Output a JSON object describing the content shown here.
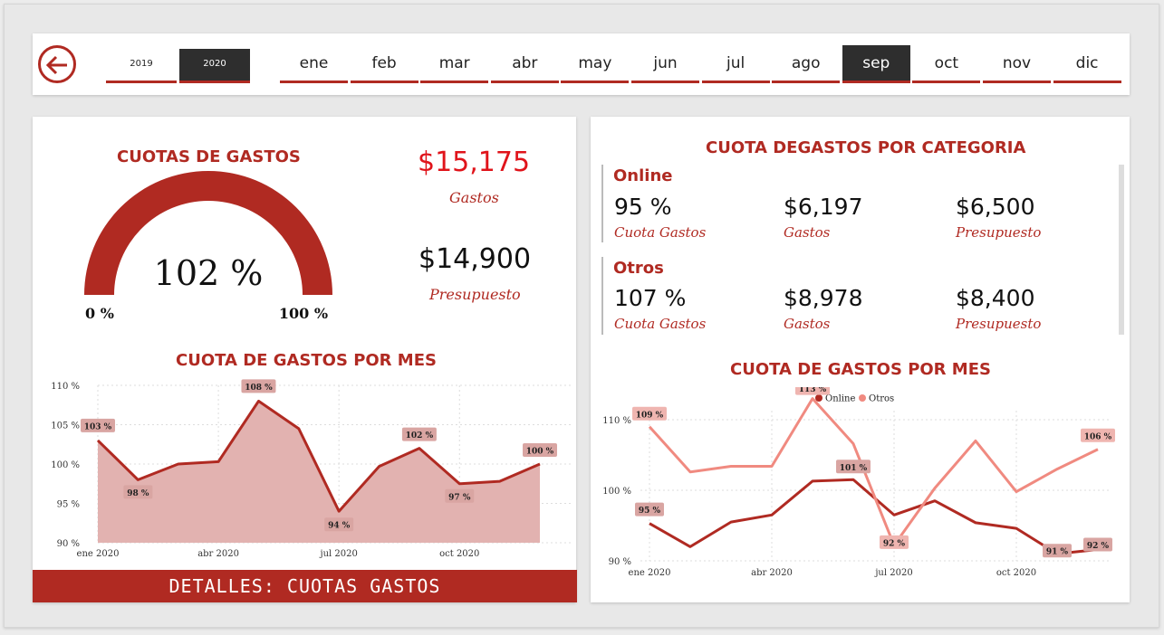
{
  "colors": {
    "accent": "#b02a22",
    "dark": "#2e2e2e",
    "area": "#e2b2b0",
    "otros": "#f08a80"
  },
  "years": [
    "2019",
    "2020"
  ],
  "active_year": "2020",
  "months": [
    "ene",
    "feb",
    "mar",
    "abr",
    "may",
    "jun",
    "jul",
    "ago",
    "sep",
    "oct",
    "nov",
    "dic"
  ],
  "active_month": "sep",
  "gauge": {
    "title": "CUOTAS DE GASTOS",
    "value_label": "102 %",
    "min_label": "0 %",
    "max_label": "100 %",
    "value": 1.02
  },
  "kpi": {
    "gastos_value": "$15,175",
    "gastos_label": "Gastos",
    "presupuesto_value": "$14,900",
    "presupuesto_label": "Presupuesto"
  },
  "left_chart_title": "CUOTA DE GASTOS POR MES",
  "details_button": "DETALLES:  CUOTAS GASTOS",
  "category_title": "CUOTA DEGASTOS POR CATEGORIA",
  "categories": [
    {
      "name": "Online",
      "cuota": "95 %",
      "cuota_label": "Cuota Gastos",
      "gastos": "$6,197",
      "gastos_label": "Gastos",
      "presupuesto": "$6,500",
      "presupuesto_label": "Presupuesto"
    },
    {
      "name": "Otros",
      "cuota": "107 %",
      "cuota_label": "Cuota Gastos",
      "gastos": "$8,978",
      "gastos_label": "Gastos",
      "presupuesto": "$8,400",
      "presupuesto_label": "Presupuesto"
    }
  ],
  "right_chart_title": "CUOTA DE GASTOS POR MES",
  "chart_data": [
    {
      "type": "area",
      "title": "CUOTA DE GASTOS POR MES",
      "x": [
        "ene 2020",
        "feb 2020",
        "mar 2020",
        "abr 2020",
        "may 2020",
        "jun 2020",
        "jul 2020",
        "ago 2020",
        "sep 2020",
        "oct 2020",
        "nov 2020",
        "dic 2020"
      ],
      "x_tick_labels": [
        "ene 2020",
        "abr 2020",
        "jul 2020",
        "oct 2020"
      ],
      "y_tick_labels": [
        "110 %",
        "105 %",
        "100 %",
        "95 %",
        "90 %"
      ],
      "ylim": [
        90,
        110
      ],
      "series": [
        {
          "values": [
            103,
            98,
            100,
            100.3,
            108,
            104.5,
            94,
            99.7,
            102,
            97.5,
            97.8,
            100
          ]
        }
      ],
      "point_labels": [
        {
          "index": 0,
          "text": "103 %"
        },
        {
          "index": 1,
          "text": "98 %"
        },
        {
          "index": 4,
          "text": "108 %"
        },
        {
          "index": 6,
          "text": "94 %"
        },
        {
          "index": 8,
          "text": "102 %"
        },
        {
          "index": 9,
          "text": "97 %"
        },
        {
          "index": 11,
          "text": "100 %"
        }
      ],
      "grid": true
    },
    {
      "type": "line",
      "title": "CUOTA DE GASTOS POR MES",
      "x": [
        "ene 2020",
        "feb 2020",
        "mar 2020",
        "abr 2020",
        "may 2020",
        "jun 2020",
        "jul 2020",
        "ago 2020",
        "sep 2020",
        "oct 2020",
        "nov 2020",
        "dic 2020"
      ],
      "x_tick_labels": [
        "ene 2020",
        "abr 2020",
        "jul 2020",
        "oct 2020"
      ],
      "y_tick_labels": [
        "110 %",
        "100 %",
        "90 %"
      ],
      "ylim": [
        90,
        110
      ],
      "legend": "top-center",
      "series": [
        {
          "name": "Online",
          "values": [
            95.3,
            92,
            95.5,
            96.5,
            101.3,
            101.5,
            96.5,
            98.5,
            95.4,
            94.6,
            91,
            91.6
          ]
        },
        {
          "name": "Otros",
          "values": [
            109,
            102.6,
            103.4,
            103.4,
            113,
            106.6,
            92.2,
            100.3,
            107,
            99.8,
            103,
            105.8
          ]
        }
      ],
      "point_labels": [
        {
          "series": 0,
          "index": 0,
          "text": "95 %"
        },
        {
          "series": 0,
          "index": 5,
          "text": "101 %"
        },
        {
          "series": 0,
          "index": 10,
          "text": "91 %"
        },
        {
          "series": 0,
          "index": 11,
          "text": "92 %"
        },
        {
          "series": 1,
          "index": 0,
          "text": "109 %"
        },
        {
          "series": 1,
          "index": 4,
          "text": "113 %"
        },
        {
          "series": 1,
          "index": 6,
          "text": "92 %"
        },
        {
          "series": 1,
          "index": 11,
          "text": "106 %"
        }
      ],
      "grid": true
    }
  ]
}
